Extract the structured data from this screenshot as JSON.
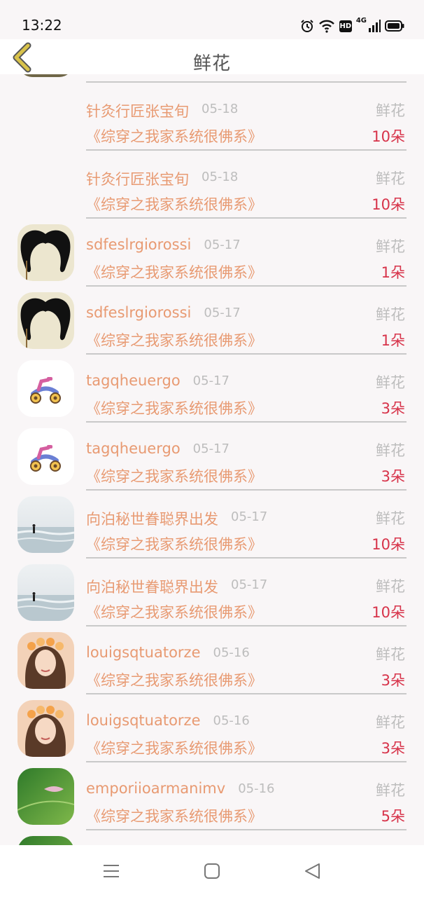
{
  "status_bar": {
    "time": "13:22",
    "icons": [
      "alarm-icon",
      "wifi-icon",
      "hd-badge",
      "4g-signal-icon",
      "battery-icon"
    ],
    "hd_label": "HD",
    "network_label": "4G"
  },
  "header": {
    "title": "鲜花",
    "back_icon": "chevron-left-icon",
    "back_color": "#d8c24a"
  },
  "colors": {
    "username": "#e89a72",
    "book": "#e89a72",
    "amount": "#d7334a",
    "meta": "#bdbdbd",
    "background": "#f9f6f7"
  },
  "records": [
    {
      "avatar": "landscape-thumb",
      "username": "",
      "date": "",
      "gift": "",
      "book": "",
      "amount": ""
    },
    {
      "avatar": "",
      "username": "针灸行匠张宝旬",
      "date": "05-18",
      "gift": "鲜花",
      "book": "《综穿之我家系统很佛系》",
      "amount": "10朵"
    },
    {
      "avatar": "",
      "username": "针灸行匠张宝旬",
      "date": "05-18",
      "gift": "鲜花",
      "book": "《综穿之我家系统很佛系》",
      "amount": "10朵"
    },
    {
      "avatar": "mustache",
      "username": "sdfeslrgiorossi",
      "date": "05-17",
      "gift": "鲜花",
      "book": "《综穿之我家系统很佛系》",
      "amount": "1朵"
    },
    {
      "avatar": "mustache",
      "username": "sdfeslrgiorossi",
      "date": "05-17",
      "gift": "鲜花",
      "book": "《综穿之我家系统很佛系》",
      "amount": "1朵"
    },
    {
      "avatar": "scooter",
      "username": "tagqheuergo",
      "date": "05-17",
      "gift": "鲜花",
      "book": "《综穿之我家系统很佛系》",
      "amount": "3朵"
    },
    {
      "avatar": "scooter",
      "username": "tagqheuergo",
      "date": "05-17",
      "gift": "鲜花",
      "book": "《综穿之我家系统很佛系》",
      "amount": "3朵"
    },
    {
      "avatar": "beach",
      "username": "向泊秘世眷聪界出发",
      "date": "05-17",
      "gift": "鲜花",
      "book": "《综穿之我家系统很佛系》",
      "amount": "10朵"
    },
    {
      "avatar": "beach",
      "username": "向泊秘世眷聪界出发",
      "date": "05-17",
      "gift": "鲜花",
      "book": "《综穿之我家系统很佛系》",
      "amount": "10朵"
    },
    {
      "avatar": "portrait",
      "username": "louigsqtuatorze",
      "date": "05-16",
      "gift": "鲜花",
      "book": "《综穿之我家系统很佛系》",
      "amount": "3朵"
    },
    {
      "avatar": "portrait",
      "username": "louigsqtuatorze",
      "date": "05-16",
      "gift": "鲜花",
      "book": "《综穿之我家系统很佛系》",
      "amount": "3朵"
    },
    {
      "avatar": "leaf",
      "username": "emporiioarmanimv",
      "date": "05-16",
      "gift": "鲜花",
      "book": "《综穿之我家系统很佛系》",
      "amount": "5朵"
    },
    {
      "avatar": "leaf",
      "username": "",
      "date": "",
      "gift": "",
      "book": "",
      "amount": ""
    }
  ],
  "nav_bar": {
    "icons": [
      "menu-icon",
      "home-icon",
      "back-icon"
    ]
  }
}
